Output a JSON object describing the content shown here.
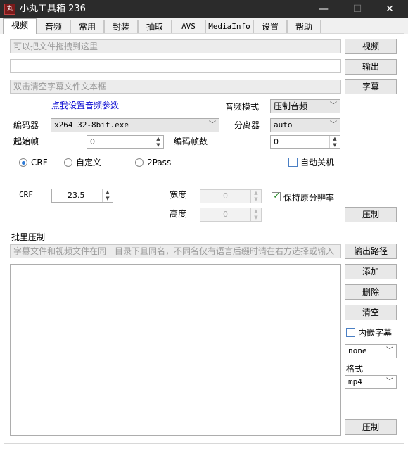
{
  "window": {
    "app_icon_text": "丸",
    "title": "小丸工具箱 236",
    "minimize": "—",
    "maximize": "☐",
    "close": "✕"
  },
  "tabs": [
    "视频",
    "音频",
    "常用",
    "封装",
    "抽取",
    "AVS",
    "MediaInfo",
    "设置",
    "帮助"
  ],
  "video": {
    "drop_placeholder": "可以把文件拖拽到这里",
    "output_value": "",
    "subtitle_placeholder": "双击清空字幕文件文本框",
    "video_button": "视频",
    "output_button": "输出",
    "subtitle_button": "字幕",
    "audio_params_link": "点我设置音频参数",
    "audio_mode_label": "音频模式",
    "audio_mode_value": "压制音频",
    "encoder_label": "编码器",
    "encoder_value": "x264_32-8bit.exe",
    "splitter_label": "分离器",
    "splitter_value": "auto",
    "start_frame_label": "起始帧",
    "start_frame_value": "0",
    "frame_count_label": "编码帧数",
    "frame_count_value": "0",
    "mode_crf": "CRF",
    "mode_custom": "自定义",
    "mode_2pass": "2Pass",
    "auto_shutdown": "自动关机",
    "crf_label": "CRF",
    "crf_value": "23.5",
    "width_label": "宽度",
    "width_value": "0",
    "height_label": "高度",
    "height_value": "0",
    "keep_resolution": "保持原分辨率",
    "encode_button": "压制"
  },
  "batch": {
    "section_title": "批里压制",
    "hint": "字幕文件和视频文件在同一目录下且同名，不同名仅有语言后缀时请在右方选择或输入",
    "output_path_button": "输出路径",
    "add_button": "添加",
    "delete_button": "删除",
    "clear_button": "清空",
    "embed_subtitle": "内嵌字幕",
    "subtitle_lang_value": "none",
    "format_label": "格式",
    "format_value": "mp4",
    "encode_button": "压制"
  }
}
